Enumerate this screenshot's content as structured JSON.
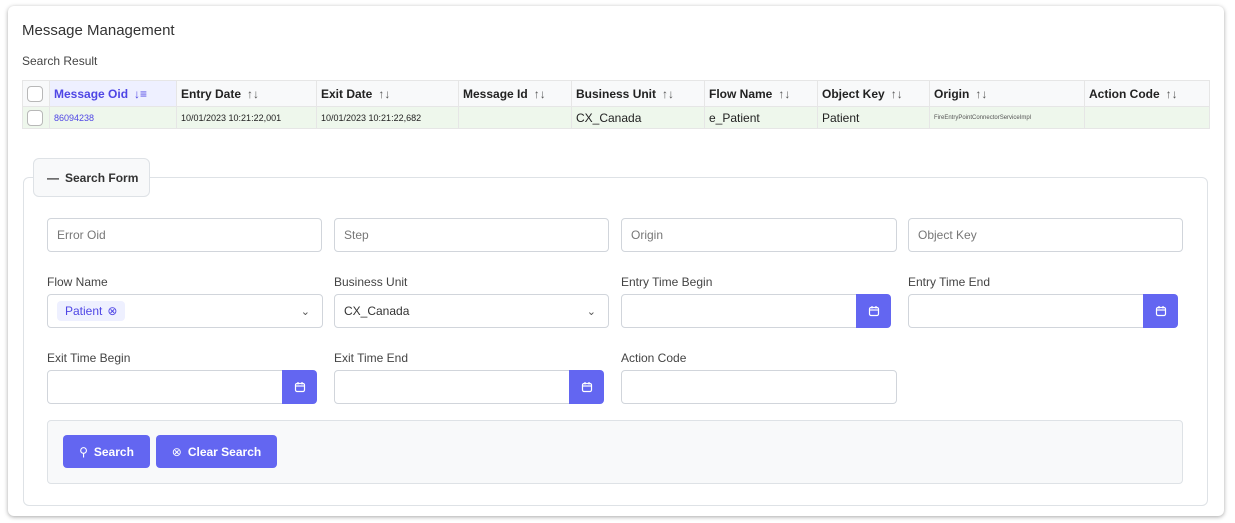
{
  "page": {
    "title": "Message Management",
    "subtitle": "Search Result"
  },
  "table": {
    "columns": [
      {
        "label": "Message Oid",
        "sort_icon": "↓≡",
        "sorted": true
      },
      {
        "label": "Entry Date",
        "sort_icon": "↑↓"
      },
      {
        "label": "Exit Date",
        "sort_icon": "↑↓"
      },
      {
        "label": "Message Id",
        "sort_icon": "↑↓"
      },
      {
        "label": "Business Unit",
        "sort_icon": "↑↓"
      },
      {
        "label": "Flow Name",
        "sort_icon": "↑↓"
      },
      {
        "label": "Object Key",
        "sort_icon": "↑↓"
      },
      {
        "label": "Origin",
        "sort_icon": "↑↓"
      },
      {
        "label": "Action Code",
        "sort_icon": "↑↓"
      }
    ],
    "rows": [
      {
        "message_oid": "86094238",
        "entry_date": "10/01/2023 10:21:22,001",
        "exit_date": "10/01/2023 10:21:22,682",
        "message_id": "",
        "business_unit": "CX_Canada",
        "flow_name": "e_Patient",
        "object_key": "Patient",
        "origin": "FireEntryPointConnectorServiceImpl",
        "action_code": ""
      }
    ]
  },
  "search_form": {
    "legend_icon": "—",
    "legend": "Search Form",
    "error_oid_placeholder": "Error Oid",
    "step_placeholder": "Step",
    "origin_placeholder": "Origin",
    "object_key_placeholder": "Object Key",
    "flow_name_label": "Flow Name",
    "flow_name_chip": "Patient",
    "flow_name_chip_remove": "⊗",
    "business_unit_label": "Business Unit",
    "business_unit_value": "CX_Canada",
    "dropdown_chevron": "⌄",
    "entry_time_begin_label": "Entry Time Begin",
    "entry_time_end_label": "Entry Time End",
    "exit_time_begin_label": "Exit Time Begin",
    "exit_time_end_label": "Exit Time End",
    "action_code_label": "Action Code",
    "search_icon": "⚲",
    "search_button": "Search",
    "clear_icon": "⊗",
    "clear_button": "Clear Search"
  },
  "colors": {
    "accent": "#6366f1",
    "row_bg": "#eef7ec",
    "link": "#4f46e5"
  }
}
